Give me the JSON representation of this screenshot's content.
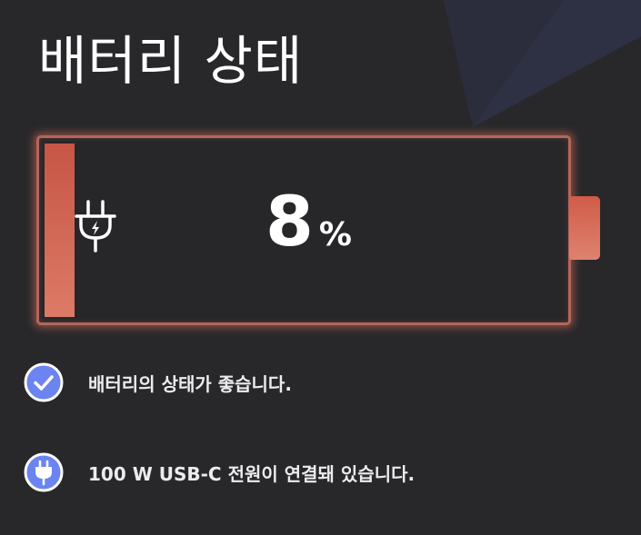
{
  "page": {
    "title": "배터리 상태"
  },
  "battery": {
    "level": 0.08,
    "percent_value": "8",
    "percent_sign": "%",
    "charging_icon": "plug-icon",
    "fill_color": "#d0604e",
    "outline_color": "#b4665b"
  },
  "status": [
    {
      "icon": "check-circle-icon",
      "text": "배터리의 상태가 좋습니다."
    },
    {
      "icon": "plug-circle-icon",
      "text": "100 W USB-C 전원이 연결돼 있습니다."
    }
  ],
  "colors": {
    "background": "#28282b",
    "accent_blue": "#6b84f0",
    "text": "#ffffff"
  }
}
